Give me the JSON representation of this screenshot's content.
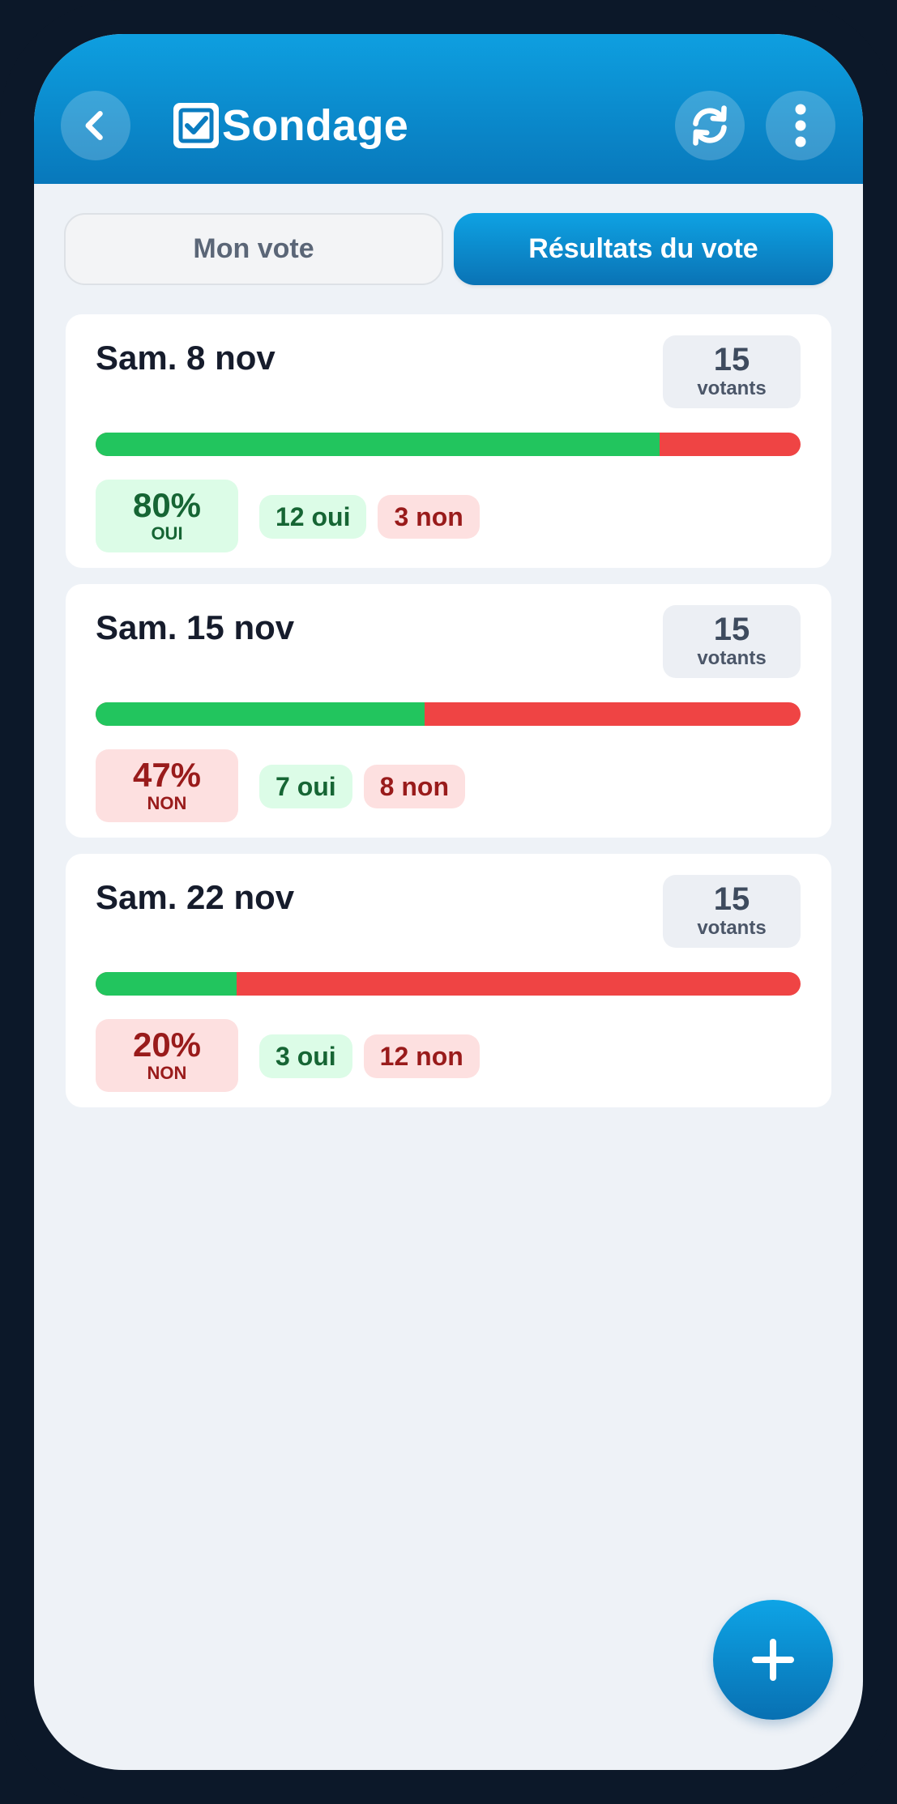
{
  "header": {
    "title": "Sondage",
    "icons": {
      "back": "chevron-left-icon",
      "logo": "checkbox-icon",
      "refresh": "refresh-icon",
      "more": "more-vertical-icon"
    }
  },
  "tabs": [
    {
      "label": "Mon vote",
      "active": false
    },
    {
      "label": "Résultats du vote",
      "active": true
    }
  ],
  "results": [
    {
      "date": "Sam. 8 nov",
      "voters_count": "15",
      "voters_label": "votants",
      "yes_fraction": 0.8,
      "percent": "80%",
      "verdict": "OUI",
      "verdict_type": "oui",
      "yes_label": "12 oui",
      "no_label": "3 non"
    },
    {
      "date": "Sam. 15 nov",
      "voters_count": "15",
      "voters_label": "votants",
      "yes_fraction": 0.4667,
      "percent": "47%",
      "verdict": "NON",
      "verdict_type": "non",
      "yes_label": "7 oui",
      "no_label": "8 non"
    },
    {
      "date": "Sam. 22 nov",
      "voters_count": "15",
      "voters_label": "votants",
      "yes_fraction": 0.2,
      "percent": "20%",
      "verdict": "NON",
      "verdict_type": "non",
      "yes_label": "3 oui",
      "no_label": "12 non"
    }
  ],
  "fab": {
    "icon": "plus-icon"
  },
  "colors": {
    "accent": "#0a8fd4",
    "yes": "#22c55e",
    "no": "#ef4444",
    "yes_text": "#166534",
    "no_text": "#991b1b",
    "frame": "#0c1829"
  }
}
